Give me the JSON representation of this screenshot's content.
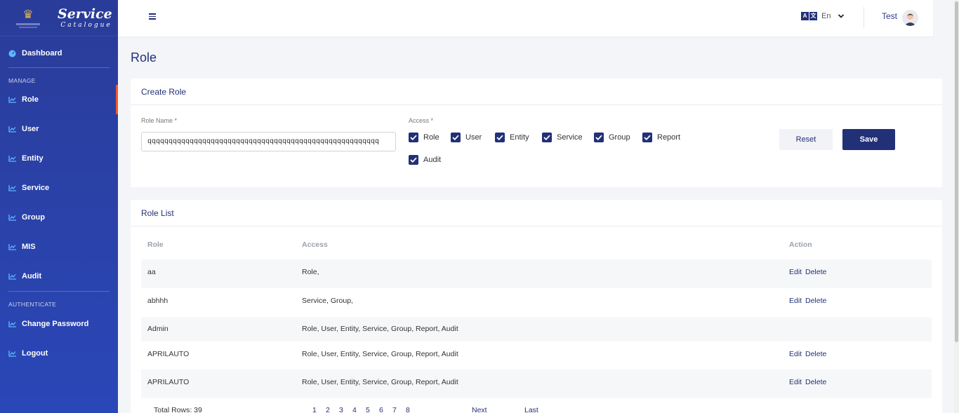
{
  "brand": {
    "title": "Service",
    "subtitle": "Catalogue"
  },
  "sidebar": {
    "dashboard": "Dashboard",
    "manage_label": "MANAGE",
    "items": [
      {
        "label": "Role",
        "active": true
      },
      {
        "label": "User"
      },
      {
        "label": "Entity"
      },
      {
        "label": "Service"
      },
      {
        "label": "Group"
      },
      {
        "label": "MIS"
      },
      {
        "label": "Audit"
      }
    ],
    "authenticate_label": "AUTHENTICATE",
    "change_password": "Change Password",
    "logout": "Logout"
  },
  "topbar": {
    "language": "En",
    "user": "Test"
  },
  "page": {
    "title": "Role"
  },
  "create_role": {
    "heading": "Create Role",
    "role_name_label": "Role Name *",
    "role_name_value": "qqqqqqqqqqqqqqqqqqqqqqqqqqqqqqqqqqqqqqqqqqqqqqqqqqqqqqq",
    "access_label": "Access *",
    "access": [
      {
        "label": "Role",
        "checked": true
      },
      {
        "label": "User",
        "checked": true
      },
      {
        "label": "Entity",
        "checked": true
      },
      {
        "label": "Service",
        "checked": true
      },
      {
        "label": "Group",
        "checked": true
      },
      {
        "label": "Report",
        "checked": true
      },
      {
        "label": "Audit",
        "checked": true
      }
    ],
    "reset_label": "Reset",
    "save_label": "Save"
  },
  "role_list": {
    "heading": "Role List",
    "columns": [
      "Role",
      "Access",
      "Action"
    ],
    "rows": [
      {
        "role": "aa",
        "access": "Role,",
        "edit": "Edit",
        "delete": "Delete"
      },
      {
        "role": "abhhh",
        "access": "Service, Group,",
        "edit": "Edit",
        "delete": "Delete"
      },
      {
        "role": "Admin",
        "access": "Role, User, Entity, Service, Group, Report, Audit",
        "edit": "",
        "delete": ""
      },
      {
        "role": "APRILAUTO",
        "access": "Role, User, Entity, Service, Group, Report, Audit",
        "edit": "Edit",
        "delete": "Delete"
      },
      {
        "role": "APRILAUTO",
        "access": "Role, User, Entity, Service, Group, Report, Audit",
        "edit": "Edit",
        "delete": "Delete"
      }
    ],
    "total_rows": "Total Rows: 39",
    "pages": [
      "1",
      "2",
      "3",
      "4",
      "5",
      "6",
      "7",
      "8"
    ],
    "next": "Next",
    "last": "Last"
  }
}
